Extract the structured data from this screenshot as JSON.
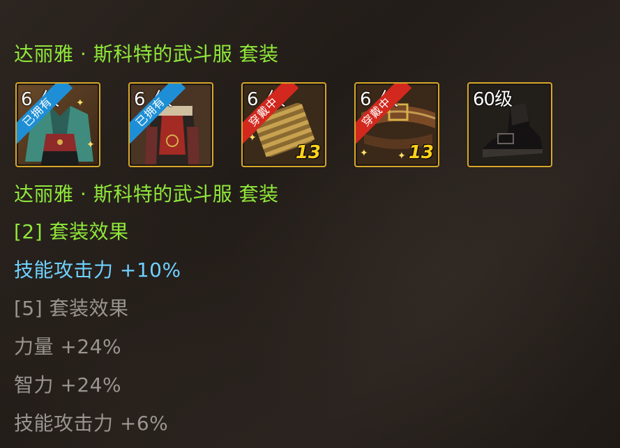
{
  "set_title_top": "达丽雅 · 斯科特的武斗服 套装",
  "set_title": "达丽雅 · 斯科特的武斗服 套装",
  "slots": [
    {
      "level": "6",
      "level_suffix": "级",
      "badge": "已拥有",
      "badge_color": "#1e8fd6",
      "enhance": "",
      "icon": "coat-icon"
    },
    {
      "level": "6",
      "level_suffix": "级",
      "badge": "已拥有",
      "badge_color": "#1e8fd6",
      "enhance": "",
      "icon": "pants-icon"
    },
    {
      "level": "6",
      "level_suffix": "级",
      "badge": "穿戴中",
      "badge_color": "#d2281e",
      "enhance": "13",
      "icon": "shoulder-icon"
    },
    {
      "level": "6",
      "level_suffix": "级",
      "badge": "穿戴中",
      "badge_color": "#d2281e",
      "enhance": "13",
      "icon": "belt-icon"
    },
    {
      "level": "60级",
      "level_suffix": "",
      "badge": "",
      "badge_color": "",
      "enhance": "",
      "icon": "shoes-icon"
    }
  ],
  "effects": {
    "two_piece": {
      "label": "[2] 套装效果",
      "stat": "技能攻击力 +10%"
    },
    "five_piece": {
      "label": "[5] 套装效果",
      "stats": [
        "力量 +24%",
        "智力 +24%",
        "技能攻击力 +6%"
      ]
    }
  },
  "colors": {
    "active_green": "#8fe83a",
    "active_stat": "#6fd1ff",
    "inactive_gray": "#9a9590",
    "slot_border": "#d8a62a"
  }
}
